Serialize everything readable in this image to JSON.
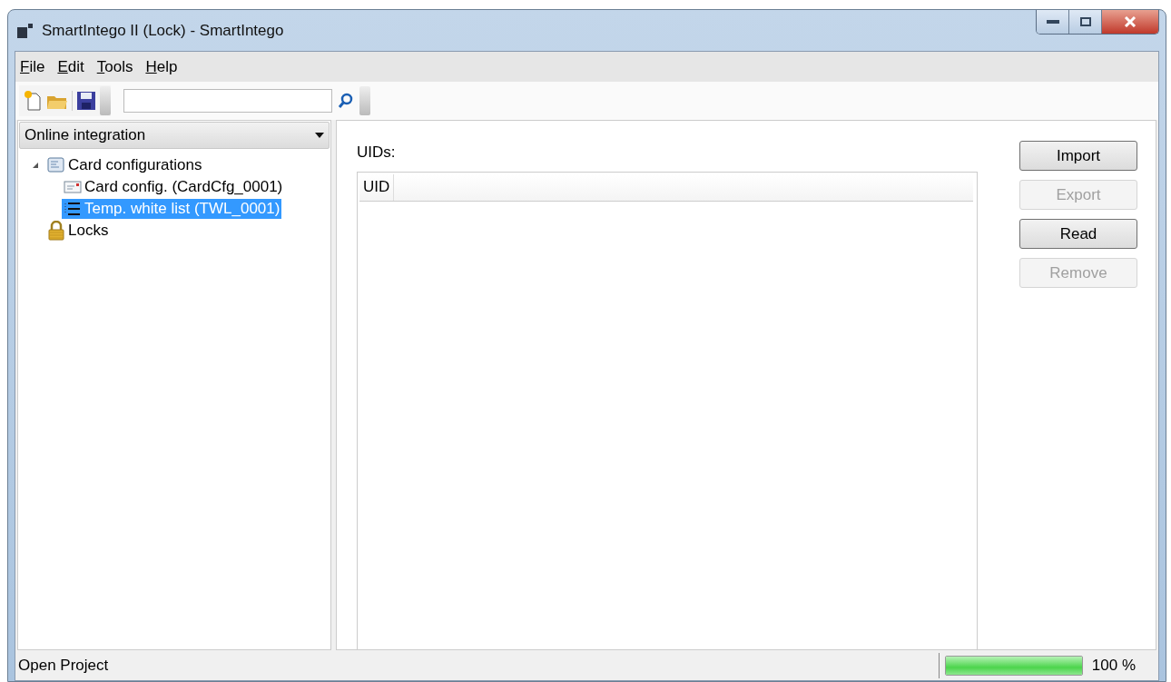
{
  "window": {
    "title": "SmartIntego II (Lock) - SmartIntego"
  },
  "menu": [
    {
      "label": "File"
    },
    {
      "label": "Edit"
    },
    {
      "label": "Tools"
    },
    {
      "label": "Help"
    }
  ],
  "sidebar": {
    "dropdown": "Online integration",
    "tree": [
      {
        "label": "Card configurations",
        "kind": "folder",
        "expanded": true,
        "selected": false,
        "children": [
          {
            "label": "Card config. (CardCfg_0001)",
            "kind": "card",
            "selected": false
          },
          {
            "label": "Temp. white list (TWL_0001)",
            "kind": "list",
            "selected": true
          }
        ]
      },
      {
        "label": "Locks",
        "kind": "lock",
        "selected": false
      }
    ]
  },
  "content": {
    "label": "UIDs:",
    "table": {
      "columns": [
        "UID"
      ]
    },
    "buttons": [
      {
        "label": "Import",
        "disabled": false
      },
      {
        "label": "Export",
        "disabled": true
      },
      {
        "label": "Read",
        "disabled": false
      },
      {
        "label": "Remove",
        "disabled": true
      }
    ]
  },
  "status_bar": {
    "text": "Open Project",
    "progress": {
      "level": 1,
      "reading": "100 %"
    }
  }
}
